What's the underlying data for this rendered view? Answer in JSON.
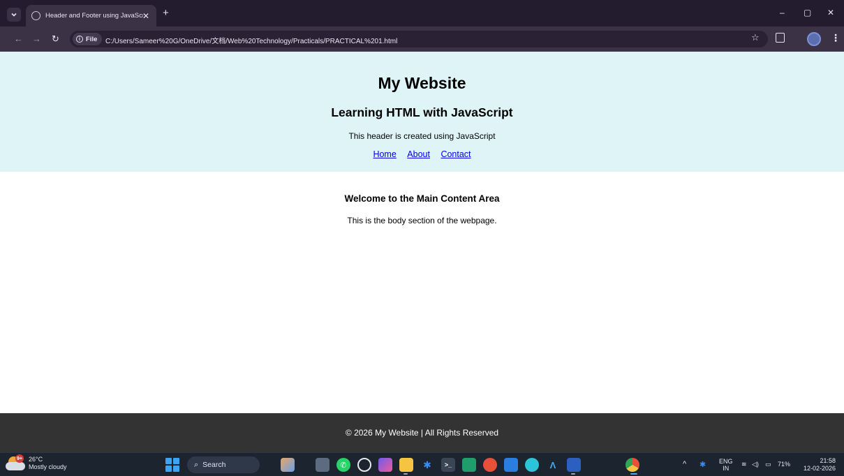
{
  "browser": {
    "tab_title": "Header and Footer using JavaScript",
    "new_tab_label": "+",
    "address_chip": "File",
    "url": "C:/Users/Sameer%20G/OneDrive/文档/Web%20Technology/Practicals/PRACTICAL%201.html",
    "window_controls": [
      "–",
      "▢",
      "✕"
    ]
  },
  "header": {
    "title": "My Website",
    "subtitle": "Learning HTML with JavaScript",
    "note": "This header is created using JavaScript",
    "nav": [
      "Home",
      "About",
      "Contact"
    ]
  },
  "main": {
    "heading": "Welcome to the Main Content Area",
    "text": "This is the body section of the webpage."
  },
  "footer": {
    "text": "© 2026 My Website | All Rights Reserved"
  },
  "taskbar": {
    "weather_badge": "9+",
    "temperature": "26°C",
    "condition": "Mostly cloudy",
    "search_label": "Search",
    "language_top": "ENG",
    "language_bottom": "IN",
    "battery": "71%",
    "time": "21:58",
    "date": "12-02-2026"
  }
}
